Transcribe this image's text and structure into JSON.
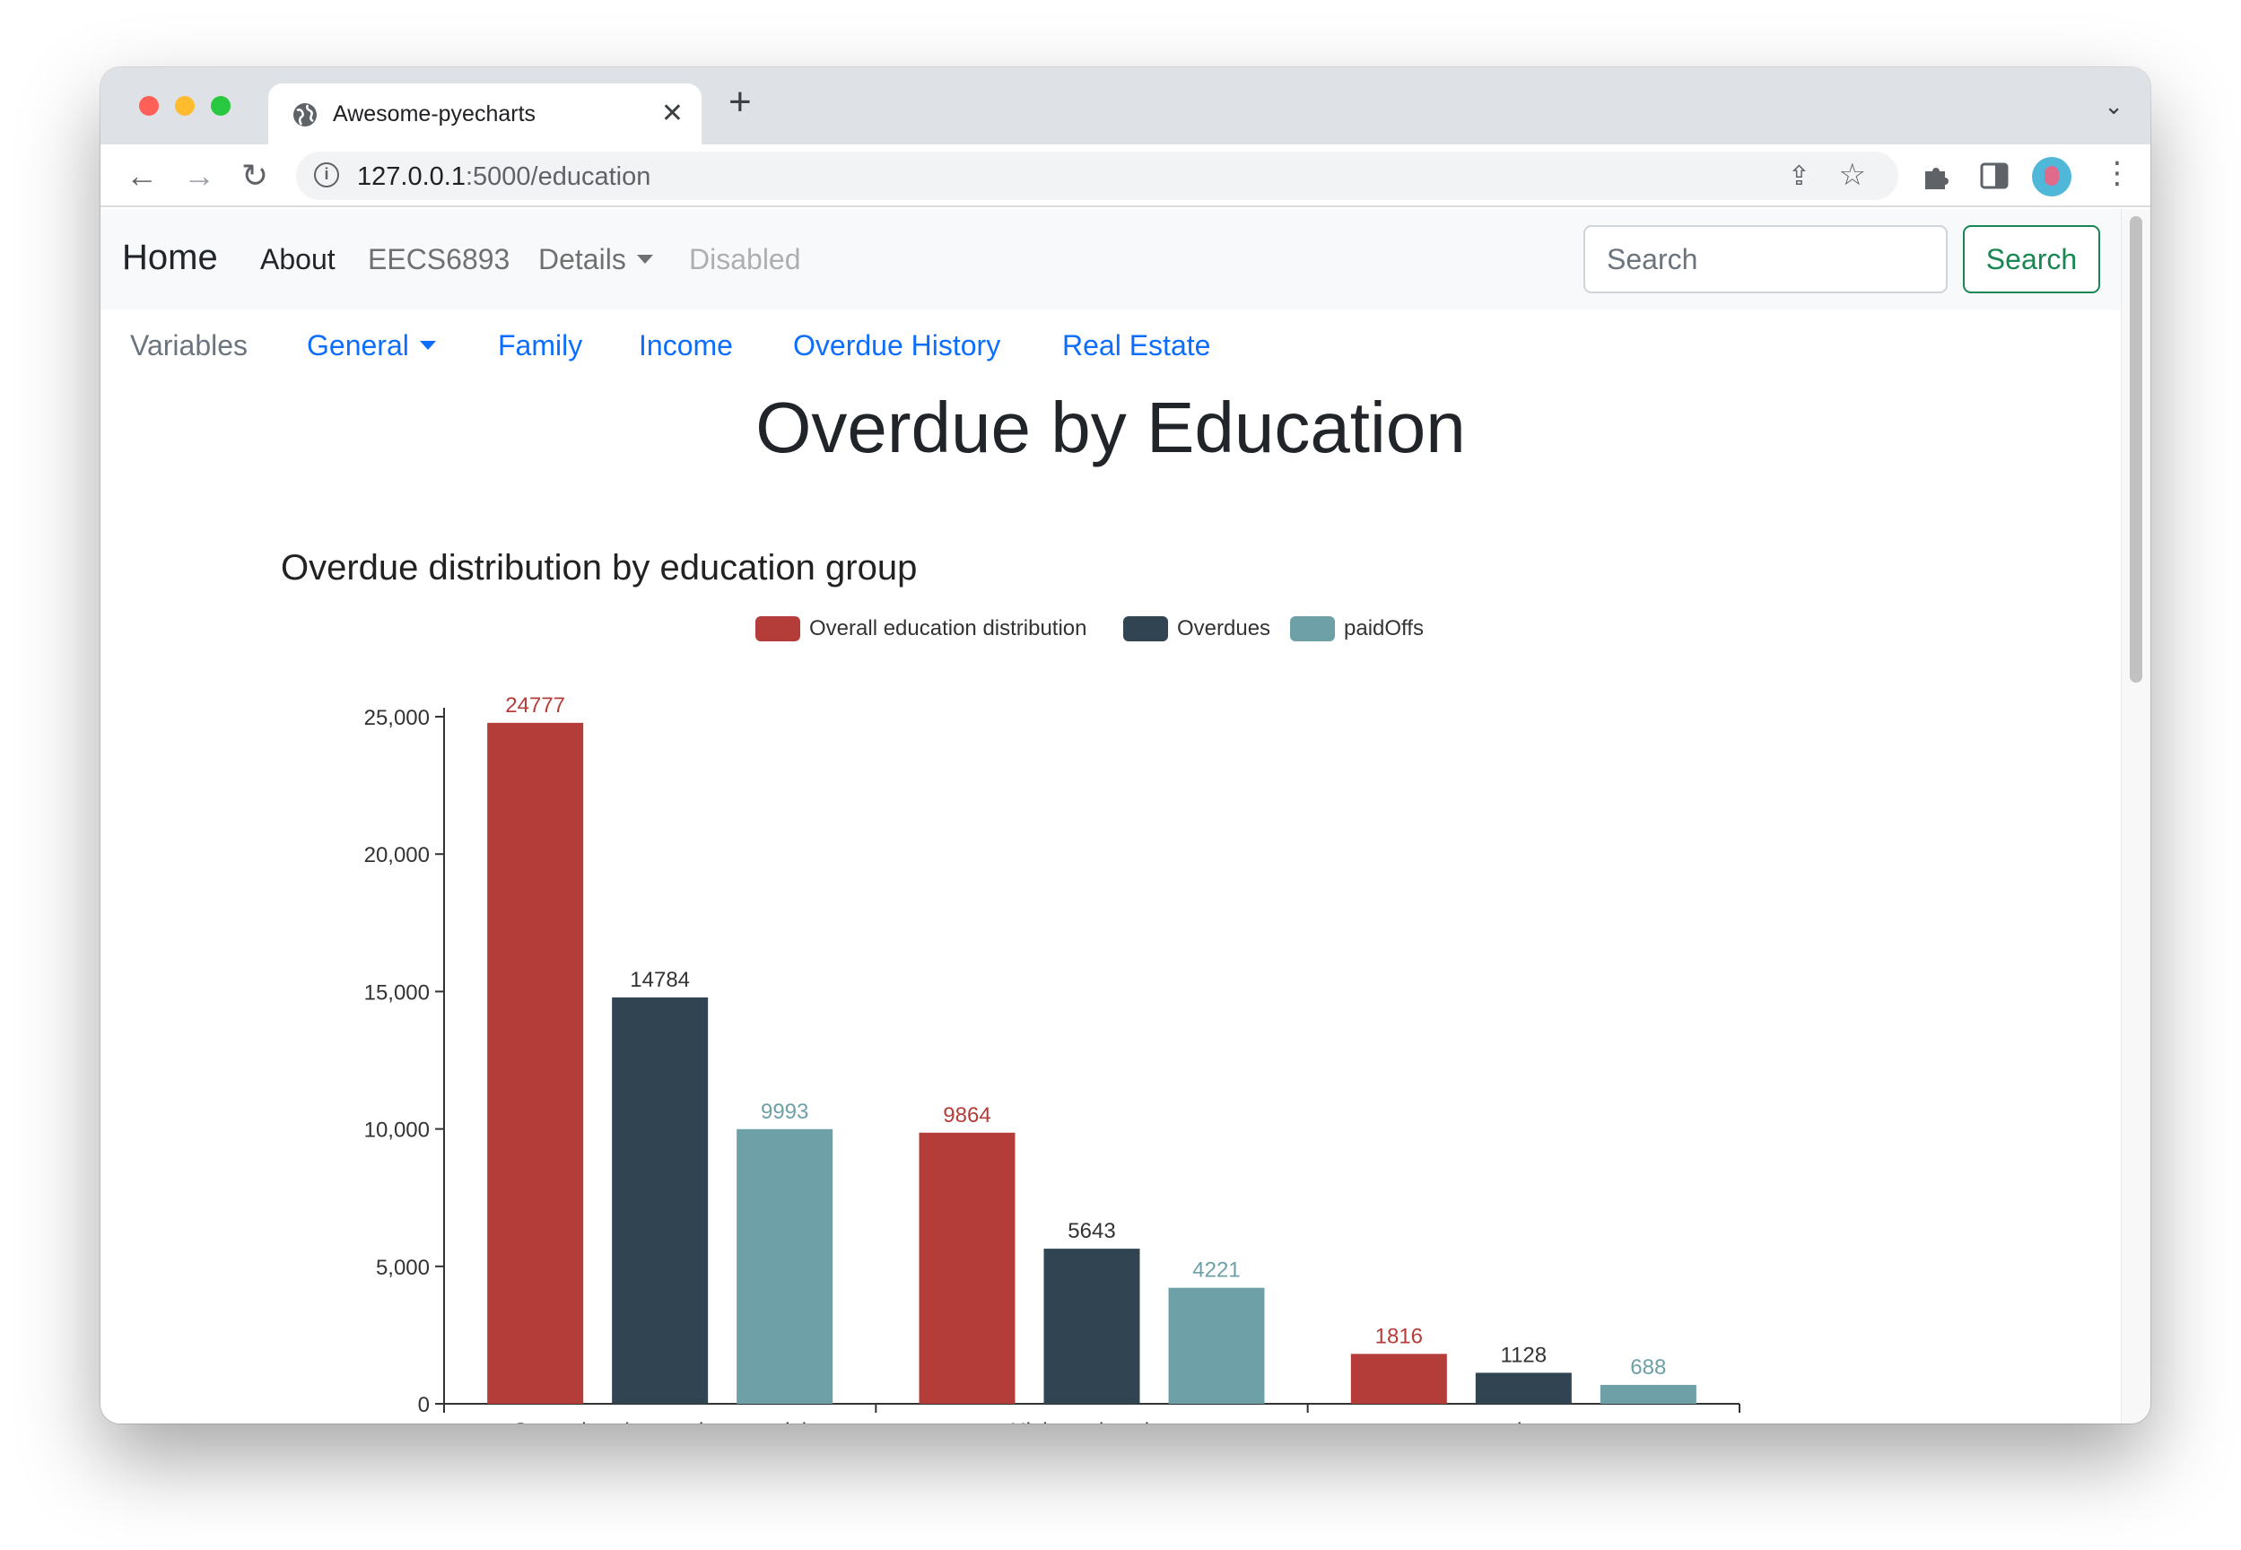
{
  "browser": {
    "tab_title": "Awesome-pyecharts",
    "url_host": "127.0.0.1",
    "url_path": ":5000/education",
    "new_tab_symbol": "+",
    "close_symbol": "✕"
  },
  "navbar": {
    "brand": "Home",
    "links": [
      "About",
      "EECS6893",
      "Details",
      "Disabled"
    ],
    "search_placeholder": "Search",
    "search_button": "Search"
  },
  "subnav": {
    "label": "Variables",
    "items": [
      "General",
      "Family",
      "Income",
      "Overdue History",
      "Real Estate"
    ]
  },
  "page": {
    "title": "Overdue by Education"
  },
  "colors": {
    "overall": "#b53d39",
    "overdues": "#304452",
    "paidoffs": "#6da1a7",
    "link": "#0d6efd",
    "success": "#198754"
  },
  "chart_data": {
    "type": "bar",
    "title": "Overdue distribution by education group",
    "categories": [
      "Secondary / secondary special",
      "Higher education",
      "other"
    ],
    "series": [
      {
        "name": "Overall education distribution",
        "values": [
          24777,
          9864,
          1816
        ]
      },
      {
        "name": "Overdues",
        "values": [
          14784,
          5643,
          1128
        ]
      },
      {
        "name": "paidOffs",
        "values": [
          9993,
          4221,
          688
        ]
      }
    ],
    "ylim": [
      0,
      25000
    ],
    "yticks": [
      "0",
      "5,000",
      "10,000",
      "15,000",
      "20,000",
      "25,000"
    ],
    "ytick_values": [
      0,
      5000,
      10000,
      15000,
      20000,
      25000
    ],
    "legend_position": "top",
    "grid": false
  }
}
